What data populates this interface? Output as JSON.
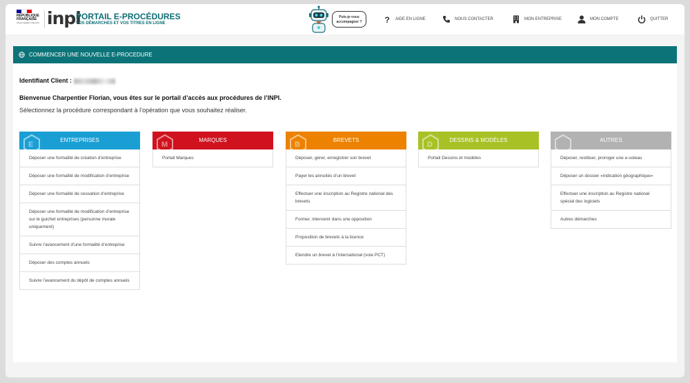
{
  "header": {
    "republique_line1": "RÉPUBLIQUE",
    "republique_line2": "FRANÇAISE",
    "devise": "Liberté Égalité Fraternité",
    "logo": "inpi",
    "portal_title": "PORTAIL E-PROCÉDURES",
    "portal_subtitle": "VOS DÉMARCHES ET VOS TITRES EN LIGNE",
    "bubble_line1": "Puis-je vous",
    "bubble_line2": "accompagner ?",
    "nav": {
      "aide": "AIDE EN LIGNE",
      "contact": "NOUS CONTACTER",
      "entreprise": "MON ENTREPRISE",
      "compte": "MON COMPTE",
      "quitter": "QUITTER"
    }
  },
  "banner": {
    "label": "COMMENCER UNE NOUVELLE E-PROCEDURE"
  },
  "main": {
    "client_label": "Identifiant Client :",
    "client_value": "15 ...",
    "welcome": "Bienvenue Charpentier Florian, vous êtes sur le portail d’accès aux procédures de l’INPI.",
    "intro": "Sélectionnez la procédure correspondant à l’opération que vous souhaitez réaliser."
  },
  "columns": [
    {
      "title": "ENTREPRISES",
      "letter": "E",
      "color": "#1a9fd5",
      "items": [
        "Déposer une formalité de création d’entreprise",
        "Déposer une formalité de modification d’entreprise",
        "Déposer une formalité de cessation d’entreprise",
        "Déposer une formalité de modification d’entreprise sur le guichet entreprises (personne morale uniquement)",
        "Suivre l’avancement d’une formalité d’entreprise",
        "Déposer des comptes annuels",
        "Suivre l’avancement du dépôt de comptes annuels"
      ]
    },
    {
      "title": "MARQUES",
      "letter": "M",
      "color": "#d0121e",
      "items": [
        "Portail Marques"
      ]
    },
    {
      "title": "BREVETS",
      "letter": "B",
      "color": "#ec8200",
      "items": [
        "Déposer, gérer, enregistrer son brevet",
        "Payer les annuités d’un brevet",
        "Effectuer une inscription au Registre national des brevets",
        "Former, intervenir dans une opposition",
        "Proposition de brevets à la licence",
        "Etendre un brevet à l’international (voie PCT)"
      ]
    },
    {
      "title": "DESSINS & MODÈLES",
      "letter": "D",
      "color": "#a8c226",
      "items": [
        "Portail Dessins et modèles"
      ]
    },
    {
      "title": "AUTRES",
      "letter": "",
      "color": "#b2b2b2",
      "items": [
        "Déposer, restituer, proroger une e-soleau",
        "Déposer un dossier «indication géographique»",
        "Effectuer une inscription au Registre national spécial des logiciels",
        "Autres démarches"
      ]
    }
  ]
}
